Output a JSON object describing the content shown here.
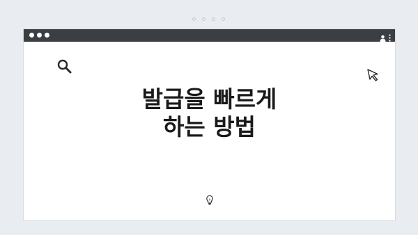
{
  "headline": {
    "line1": "발급을 빠르게",
    "line2": "하는 방법"
  },
  "icons": {
    "search": "search-icon",
    "cursor": "cursor-icon",
    "bulb": "lightbulb-icon",
    "user": "user-icon",
    "menu": "kebab-menu-icon"
  },
  "colors": {
    "background": "#e9edf2",
    "titlebar": "#3b3e43",
    "window": "#ffffff",
    "text": "#1a1a1a"
  }
}
